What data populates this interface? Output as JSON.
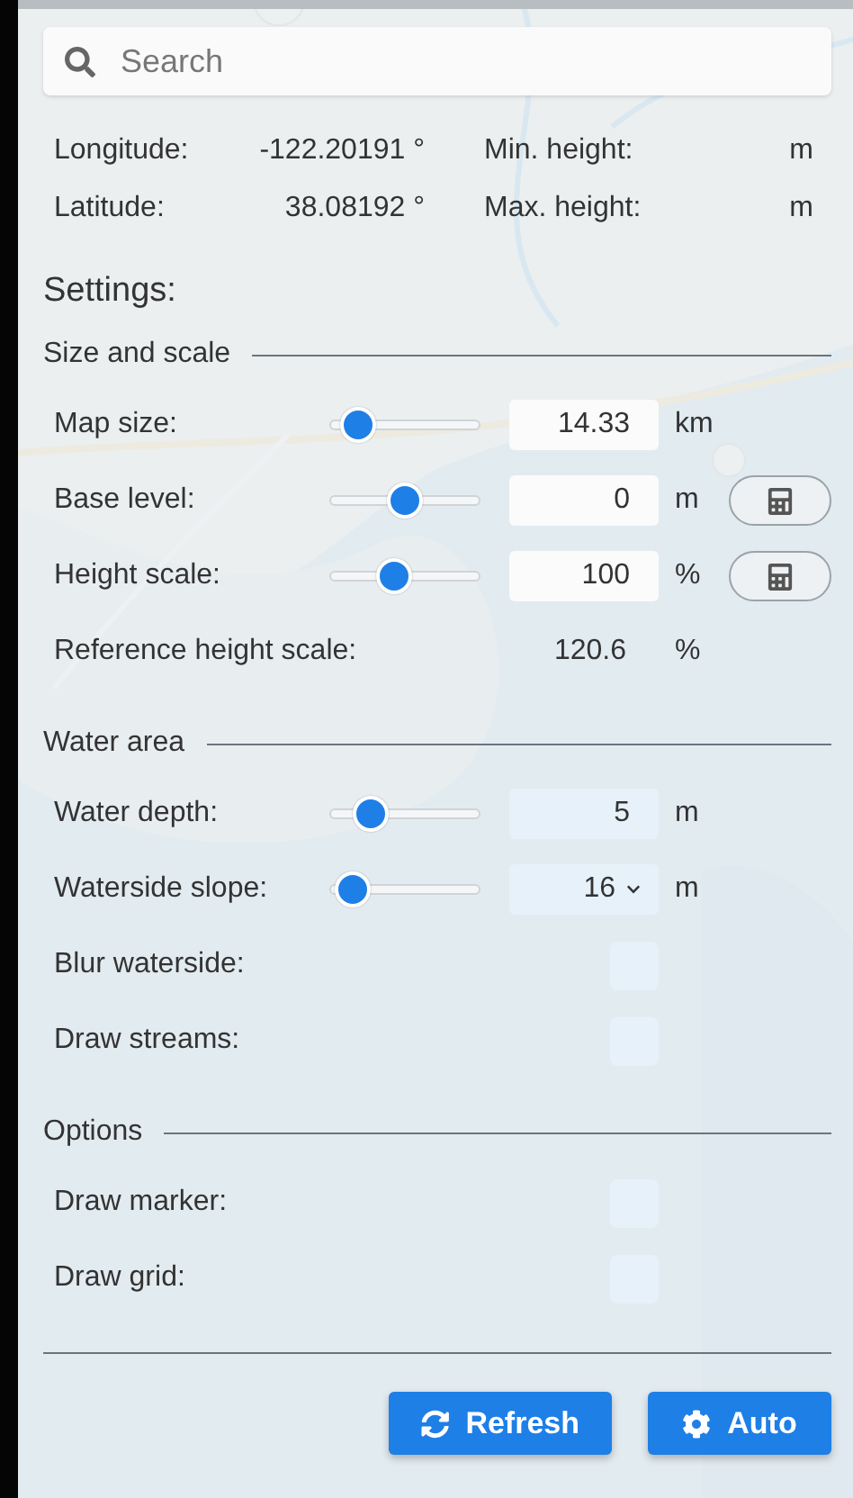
{
  "search": {
    "placeholder": "Search"
  },
  "location": [
    {
      "label": "Longitude:",
      "value": "-122.20191 °",
      "height_label": "Min. height:",
      "height_unit": "m"
    },
    {
      "label": "Latitude:",
      "value": "38.08192 °",
      "height_label": "Max. height:",
      "height_unit": "m"
    }
  ],
  "settings_title": "Settings:",
  "sections": [
    {
      "title": "Size and scale",
      "rows": [
        {
          "kind": "slider",
          "label": "Map size:",
          "level": 0.1,
          "value": "14.33",
          "unit": "km",
          "calculator": false
        },
        {
          "kind": "slider",
          "label": "Base level:",
          "level": 0.5,
          "value": "0",
          "unit": "m",
          "calculator": true
        },
        {
          "kind": "slider",
          "label": "Height scale:",
          "level": 0.4,
          "value": "100",
          "unit": "%",
          "calculator": true
        },
        {
          "kind": "value",
          "label": "Reference height scale:",
          "value": "120.6",
          "unit": "%"
        }
      ]
    },
    {
      "title": "Water area",
      "rows": [
        {
          "kind": "slider",
          "label": "Water depth:",
          "level": 0.2,
          "value": "5",
          "unit": "m",
          "calculator": false
        },
        {
          "kind": "select",
          "label": "Waterside slope:",
          "level": 0.05,
          "value": "16",
          "unit": "m"
        },
        {
          "kind": "checkbox",
          "label": "Blur waterside:",
          "checked": false
        },
        {
          "kind": "checkbox",
          "label": "Draw streams:",
          "checked": false
        }
      ]
    },
    {
      "title": "Options",
      "rows": [
        {
          "kind": "checkbox",
          "label": "Draw marker:",
          "checked": false
        },
        {
          "kind": "checkbox",
          "label": "Draw grid:",
          "checked": false
        }
      ]
    }
  ],
  "buttons": [
    {
      "kind": "refresh",
      "label": "Refresh"
    },
    {
      "kind": "auto",
      "label": "Auto"
    }
  ]
}
